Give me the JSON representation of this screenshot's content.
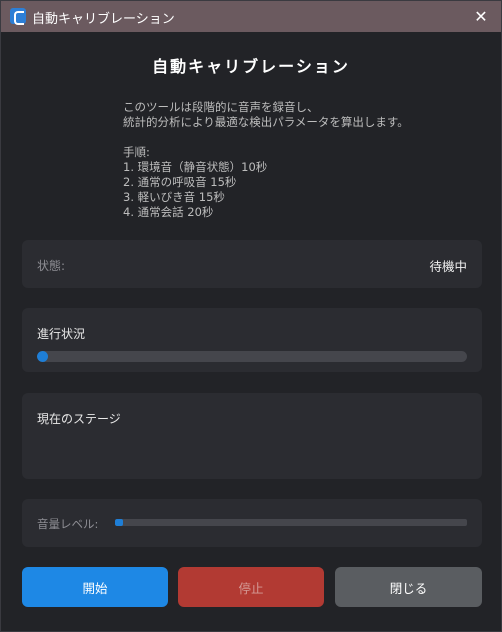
{
  "window": {
    "title": "自動キャリブレーション",
    "close_glyph": "✕"
  },
  "heading": "自動キャリブレーション",
  "description": {
    "lines_1": [
      "このツールは段階的に音声を録音し、",
      "統計的分析により最適な検出パラメータを算出します。"
    ],
    "steps_title": "手順:",
    "steps": [
      "1. 環境音（静音状態）10秒",
      "2. 通常の呼吸音 15秒",
      "3. 軽いびき音 15秒",
      "4. 通常会話 20秒"
    ]
  },
  "status": {
    "label": "状態:",
    "value": "待機中"
  },
  "progress": {
    "label": "進行状況",
    "percent": 0
  },
  "stage": {
    "label": "現在のステージ",
    "text": ""
  },
  "volume": {
    "label": "音量レベル:",
    "level": 0.01
  },
  "buttons": {
    "start": "開始",
    "stop": "停止",
    "close": "閉じる"
  },
  "colors": {
    "accent": "#1e88e5",
    "stop": "#b23a33",
    "neutral": "#5a5d61",
    "titlebar": "#6b5a5f"
  }
}
